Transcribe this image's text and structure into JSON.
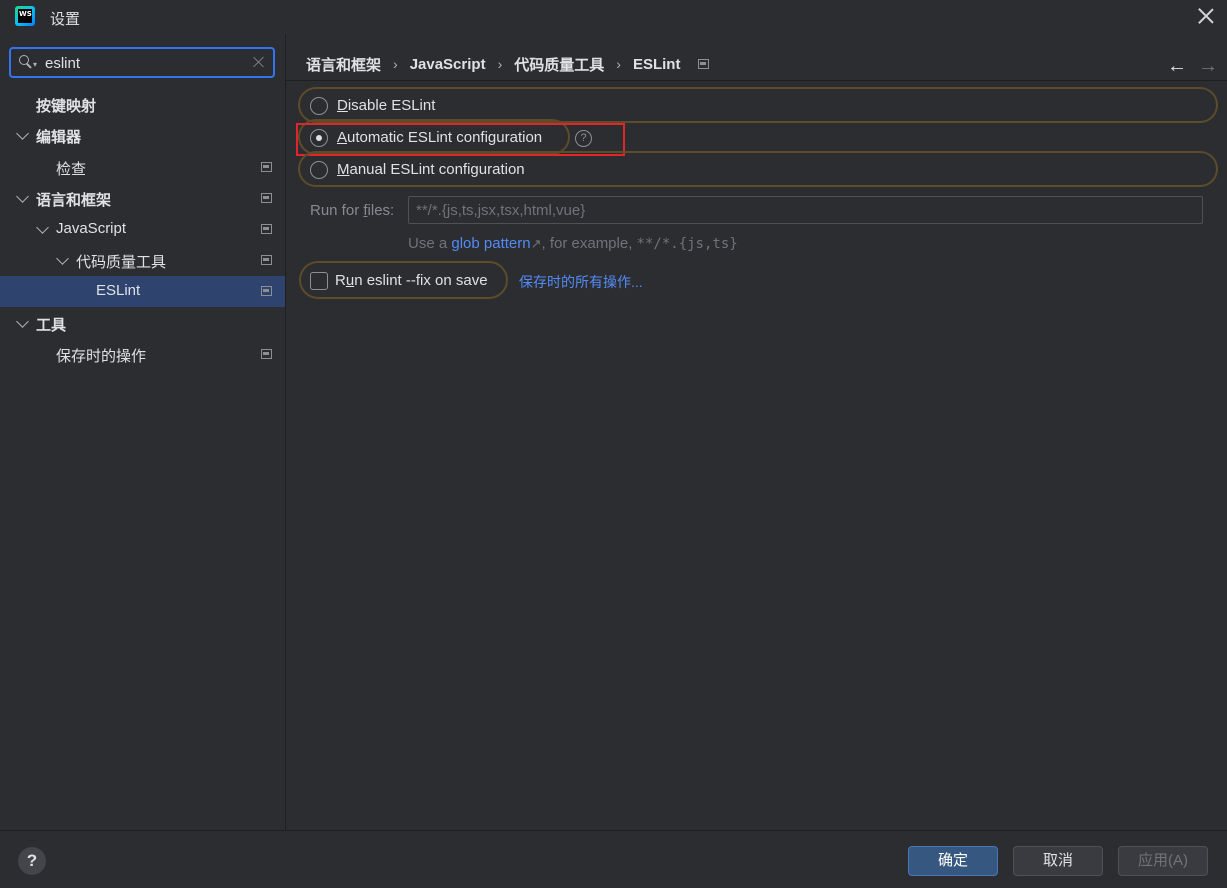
{
  "window": {
    "title": "设置",
    "logo_text": "WS"
  },
  "search": {
    "value": "eslint"
  },
  "sidebar": {
    "items": [
      {
        "label": "按键映射"
      },
      {
        "label": "编辑器"
      },
      {
        "label": "检查"
      },
      {
        "label": "语言和框架"
      },
      {
        "label": "JavaScript"
      },
      {
        "label": "代码质量工具"
      },
      {
        "label": "ESLint"
      },
      {
        "label": "工具"
      },
      {
        "label": "保存时的操作"
      }
    ]
  },
  "breadcrumb": {
    "items": [
      "语言和框架",
      "JavaScript",
      "代码质量工具",
      "ESLint"
    ],
    "separator": "›"
  },
  "nav": {
    "back": "←",
    "forward": "→"
  },
  "options": {
    "disable": {
      "prefix": "D",
      "rest": "isable ESLint"
    },
    "automatic": {
      "prefix": "A",
      "rest": "utomatic ESLint configuration",
      "help": "?"
    },
    "manual": {
      "prefix": "M",
      "rest": "anual ESLint configuration"
    },
    "selected": "automatic"
  },
  "run_for_files": {
    "label_pre": "Run for ",
    "label_u": "f",
    "label_post": "iles:",
    "value": "**/*.{js,ts,jsx,tsx,html,vue}"
  },
  "hint": {
    "pre": "Use a ",
    "link": "glob pattern",
    "arrow": "↗",
    "mid": ", for example, ",
    "code": "**/*.{js,ts}"
  },
  "fix_on_save": {
    "pre": "R",
    "u": "u",
    "post": "n eslint --fix on save",
    "checked": false
  },
  "actions_link": "保存时的所有操作...",
  "footer": {
    "help": "?",
    "ok": "确定",
    "cancel": "取消",
    "apply": "应用(A)"
  },
  "colors": {
    "accent": "#3574f0",
    "selected_row": "#2e436e",
    "highlight_outline": "#5c4c2a",
    "annotation_red": "#e0262b",
    "link": "#548af7"
  }
}
